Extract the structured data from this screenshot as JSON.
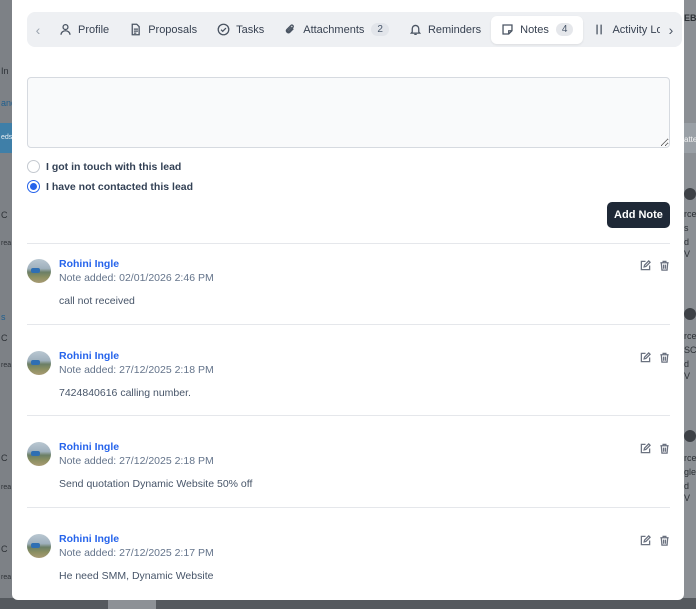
{
  "background": {
    "left_fragments": [
      "In",
      "and",
      "eds",
      "C",
      "rea",
      "s",
      "C",
      "rea",
      "C",
      "rea",
      "C",
      "rea"
    ],
    "right_fragments": [
      "EB",
      "atte",
      "rce",
      "s",
      "d V",
      "rce",
      "SC",
      "d V",
      "rce",
      "gle",
      "d V"
    ]
  },
  "tabs": {
    "prev_label": "‹",
    "next_label": "›",
    "items": [
      {
        "label": "Profile",
        "icon": "user-icon"
      },
      {
        "label": "Proposals",
        "icon": "document-icon"
      },
      {
        "label": "Tasks",
        "icon": "check-circle-icon"
      },
      {
        "label": "Attachments",
        "icon": "paperclip-icon",
        "badge": "2"
      },
      {
        "label": "Reminders",
        "icon": "bell-icon"
      },
      {
        "label": "Notes",
        "icon": "note-icon",
        "badge": "4",
        "active": true
      },
      {
        "label": "Activity Lo",
        "icon": "activity-icon"
      }
    ]
  },
  "form": {
    "note_value": "",
    "radio_contacted": "I got in touch with this lead",
    "radio_not_contacted": "I have not contacted this lead",
    "selected": "not_contacted",
    "add_button": "Add Note"
  },
  "notes": [
    {
      "author": "Rohini Ingle",
      "meta": "Note added: 02/01/2026 2:46 PM",
      "text": "call not received"
    },
    {
      "author": "Rohini Ingle",
      "meta": "Note added: 27/12/2025 2:18 PM",
      "text": "7424840616 calling number."
    },
    {
      "author": "Rohini Ingle",
      "meta": "Note added: 27/12/2025 2:18 PM",
      "text": "Send quotation Dynamic Website 50% off"
    },
    {
      "author": "Rohini Ingle",
      "meta": "Note added: 27/12/2025 2:17 PM",
      "text": "He need SMM, Dynamic Website"
    }
  ],
  "colors": {
    "accent": "#2563eb",
    "button": "#1f2937",
    "author_link": "#2563eb"
  }
}
